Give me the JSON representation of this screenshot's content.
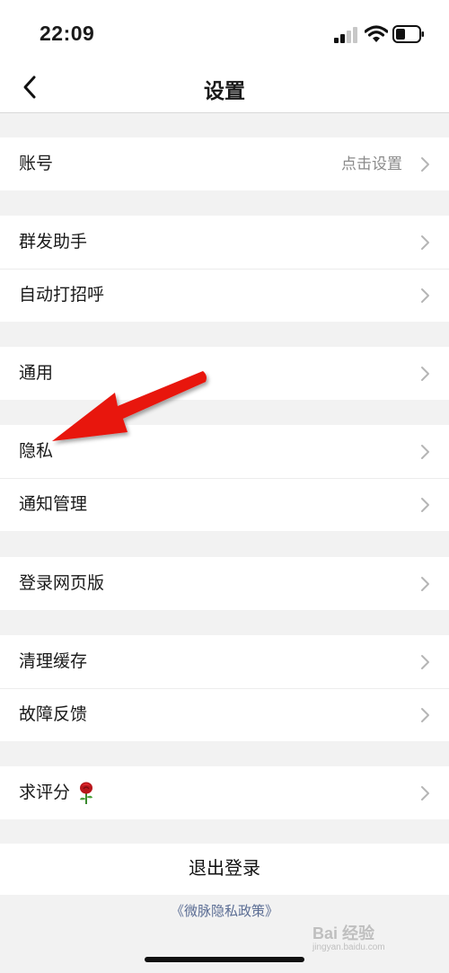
{
  "status": {
    "time": "22:09"
  },
  "header": {
    "title": "设置",
    "back_icon": "chevron-left-icon"
  },
  "groups": [
    {
      "rows": [
        {
          "label": "账号",
          "value": "点击设置"
        }
      ]
    },
    {
      "rows": [
        {
          "label": "群发助手"
        },
        {
          "label": "自动打招呼"
        }
      ]
    },
    {
      "rows": [
        {
          "label": "通用"
        }
      ]
    },
    {
      "rows": [
        {
          "label": "隐私"
        },
        {
          "label": "通知管理"
        }
      ]
    },
    {
      "rows": [
        {
          "label": "登录网页版"
        }
      ]
    },
    {
      "rows": [
        {
          "label": "清理缓存"
        },
        {
          "label": "故障反馈"
        }
      ]
    },
    {
      "rows": [
        {
          "label": "求评分",
          "emoji": "rose-icon"
        }
      ]
    }
  ],
  "logout_label": "退出登录",
  "policy_link": "《微脉隐私政策》",
  "watermark": {
    "text": "Bai 经验",
    "sub": "jingyan.baidu.com"
  },
  "annotation": {
    "type": "red-arrow",
    "color": "#e8140f",
    "points_to": "隐私"
  },
  "colors": {
    "background": "#f2f2f2",
    "card": "#ffffff",
    "link": "#5b6d94",
    "secondary_text": "#8a8a8a"
  }
}
